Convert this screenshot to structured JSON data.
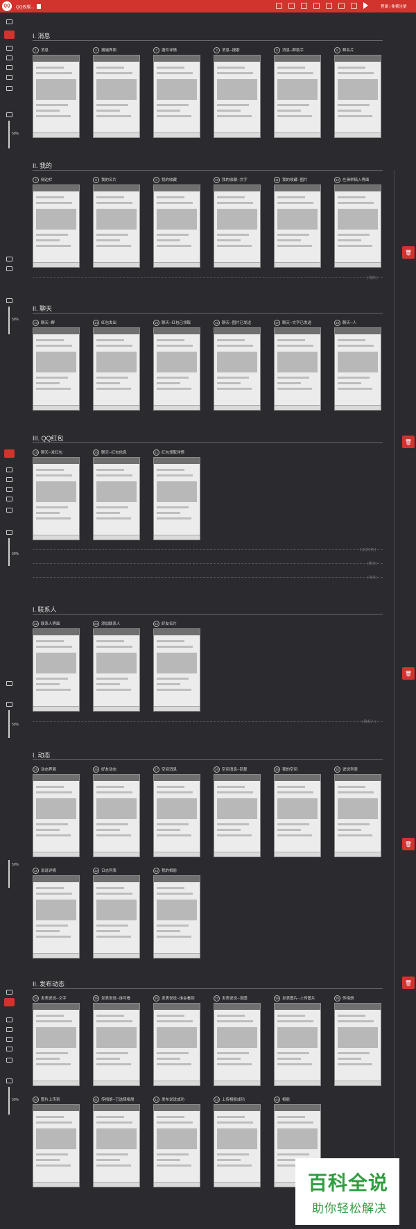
{
  "app": {
    "logo_text": "QQ",
    "doc_title": "QQ改版...",
    "login_text": "登录 | 免费注册"
  },
  "toolbar_icons": [
    "undo-icon",
    "redo-icon",
    "history-icon",
    "export-icon",
    "grid-icon",
    "layout-icon",
    "fullscreen-icon"
  ],
  "zoom": {
    "level": "50%"
  },
  "sections": [
    {
      "title": "I. 消息",
      "cards": [
        {
          "num": "1",
          "label": "消息"
        },
        {
          "num": "2",
          "label": "搜端界面"
        },
        {
          "num": "3",
          "label": "邀件详情"
        },
        {
          "num": "4",
          "label": "消息--搜索"
        },
        {
          "num": "5",
          "label": "消息--群助手"
        },
        {
          "num": "6",
          "label": "群名片"
        }
      ]
    },
    {
      "title": "II. 我的",
      "cards": [
        {
          "num": "7",
          "label": "侧边栏"
        },
        {
          "num": "8",
          "label": "我的名片"
        },
        {
          "num": "9",
          "label": "我的收藏"
        },
        {
          "num": "10",
          "label": "我的收藏--文字"
        },
        {
          "num": "11",
          "label": "我的收藏--图片"
        },
        {
          "num": "12",
          "label": "左滑举稿入界面"
        }
      ]
    },
    {
      "title": "II. 聊天",
      "cards": [
        {
          "num": "13",
          "label": "聊天--群"
        },
        {
          "num": "14",
          "label": "红包发出"
        },
        {
          "num": "15",
          "label": "聊天--红包已领取"
        },
        {
          "num": "16",
          "label": "聊天--图片已发送"
        },
        {
          "num": "17",
          "label": "聊天--文字已发送"
        },
        {
          "num": "18",
          "label": "聊天--人"
        }
      ]
    },
    {
      "title": "III. QQ红包",
      "cards": [
        {
          "num": "19",
          "label": "聊天--发红包"
        },
        {
          "num": "20",
          "label": "聊天--红包信息"
        },
        {
          "num": "21",
          "label": "红包领取详情"
        }
      ]
    },
    {
      "title": "I. 联系人",
      "cards": [
        {
          "num": "22",
          "label": "联系人界面"
        },
        {
          "num": "23",
          "label": "添加联系人"
        },
        {
          "num": "24",
          "label": "好友名片"
        }
      ]
    },
    {
      "title": "I. 动态",
      "cards": [
        {
          "num": "25",
          "label": "动态界面"
        },
        {
          "num": "26",
          "label": "好友动态"
        },
        {
          "num": "27",
          "label": "空间消息"
        },
        {
          "num": "28",
          "label": "空间消息--回复"
        },
        {
          "num": "29",
          "label": "我的空间"
        },
        {
          "num": "30",
          "label": "说说列表"
        },
        {
          "num": "31",
          "label": "说说详情"
        },
        {
          "num": "32",
          "label": "日志列表"
        },
        {
          "num": "33",
          "label": "我的相册"
        }
      ]
    },
    {
      "title": "II. 发布动态",
      "cards": [
        {
          "num": "34",
          "label": "发表说说--文字"
        },
        {
          "num": "35",
          "label": "发表说说--谁可看"
        },
        {
          "num": "36",
          "label": "发表说说--谁会看到"
        },
        {
          "num": "37",
          "label": "发表说说--发图"
        },
        {
          "num": "38",
          "label": "发表图片--上传图片"
        },
        {
          "num": "39",
          "label": "传相册"
        },
        {
          "num": "40",
          "label": "图片上传到"
        },
        {
          "num": "41",
          "label": "传相册--已选择相册"
        },
        {
          "num": "42",
          "label": "发布说说成功"
        },
        {
          "num": "43",
          "label": "上传相册成功"
        },
        {
          "num": "44",
          "label": "相册"
        }
      ]
    }
  ],
  "dash_labels": [
    "[ 我的 ]",
    "[ QQ红包 ]",
    "[ 聊天 ]",
    "[ 消息 ]",
    "[ 联系人 ]",
    "[ 动态 ]"
  ],
  "watermark": {
    "main": "百科全说",
    "sub": "助你轻松解决"
  }
}
